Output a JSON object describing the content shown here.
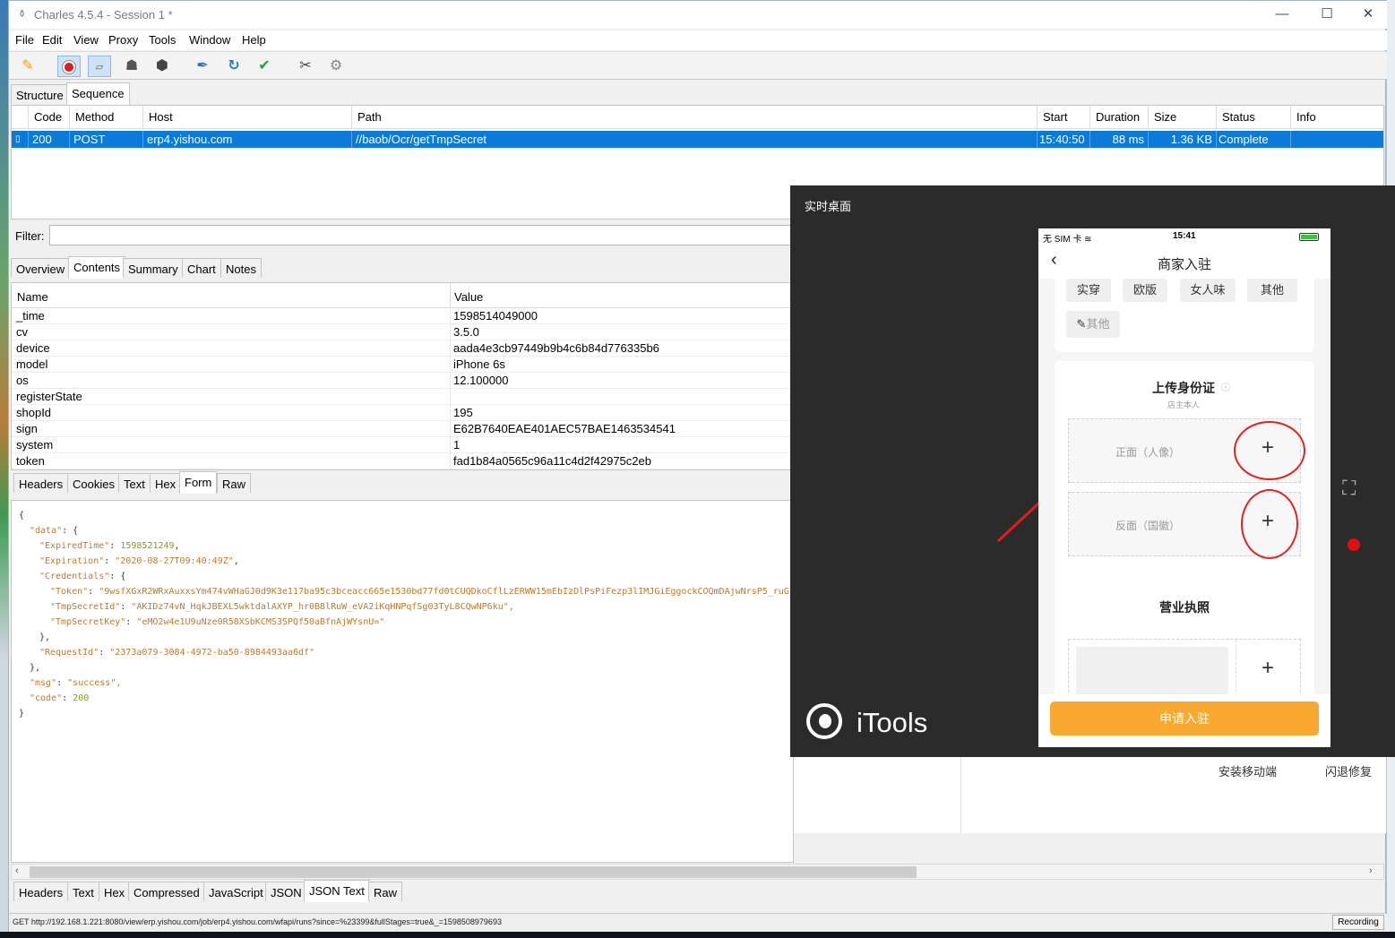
{
  "window": {
    "title": "Charles 4.5.4 - Session 1 *",
    "min": "—",
    "max": "☐",
    "close": "✕"
  },
  "menu": {
    "file": "File",
    "edit": "Edit",
    "view": "View",
    "proxy": "Proxy",
    "tools": "Tools",
    "window": "Window",
    "help": "Help"
  },
  "tabs": {
    "structure": "Structure",
    "sequence": "Sequence"
  },
  "table": {
    "headers": [
      "Code",
      "Method",
      "Host",
      "Path",
      "Start",
      "Duration",
      "Size",
      "Status",
      "Info"
    ],
    "row": {
      "code": "200",
      "method": "POST",
      "host": "erp4.yishou.com",
      "path": "//baob/Ocr/getTmpSecret",
      "start": "15:40:50",
      "duration": "88 ms",
      "size": "1.36 KB",
      "status": "Complete",
      "info": ""
    }
  },
  "filter": {
    "label": "Filter:",
    "value": ""
  },
  "detail_tabs": [
    "Overview",
    "Contents",
    "Summary",
    "Chart",
    "Notes"
  ],
  "kv": {
    "name_header": "Name",
    "value_header": "Value",
    "rows": [
      [
        "_time",
        "1598514049000"
      ],
      [
        "cv",
        "3.5.0"
      ],
      [
        "device",
        "aada4e3cb97449b9b4c6b84d776335b6"
      ],
      [
        "model",
        "iPhone 6s"
      ],
      [
        "os",
        "12.100000"
      ],
      [
        "registerState",
        ""
      ],
      [
        "shopId",
        "195"
      ],
      [
        "sign",
        "E62B7640EAE401AEC57BAE1463534541"
      ],
      [
        "system",
        "1"
      ],
      [
        "token",
        "fad1b84a0565c96a11c4d2f42975c2eb"
      ]
    ]
  },
  "request_tabs": [
    "Headers",
    "Cookies",
    "Text",
    "Hex",
    "Form",
    "Raw"
  ],
  "json": {
    "expired_time": "1598521249",
    "expiration": "\"2020-08-27T09:40:49Z\"",
    "token": "\"9wsfXGxR2WRxAuxxsYm474vWHaGJ0d9K3e117ba95c3bceacc665e1530bd77fd0tCUQDkoCflLzERWW15mEbIzDlPsPiFezp3lIMJGiEggockCOQmDAjwNrsP5_ruGs",
    "tmp_secret_id": "\"AKIDz74vN_HqkJBEXL5wktdalAXYP_hr0B8lRuW_eVA2iKqHNPqfSg03TyL8CQwNP6ku\",",
    "tmp_secret_key": "\"eMO2w4e1U9uNze0R58XSbKCMS3SPQf50aBfnAjWYsnU=\"",
    "request_id": "\"2373a079-3084-4972-ba50-8984493aa6df\"",
    "msg": "\"success\",",
    "code": "200"
  },
  "response_tabs": [
    "Headers",
    "Text",
    "Hex",
    "Compressed",
    "JavaScript",
    "JSON",
    "JSON Text",
    "Raw"
  ],
  "status": {
    "url": "GET http://192.168.1.221:8080/view/erp.yishou.com/job/erp4.yishou.com/wfapi/runs?since=%23399&fullStages=true&_=1598508979693",
    "recording": "Recording"
  },
  "itools": {
    "title": "实时桌面",
    "brand": "iTools",
    "install": "安装移动端",
    "repair": "闪退修复"
  },
  "phone": {
    "carrier": "无 SIM 卡",
    "time": "15:41",
    "page_title": "商家入驻",
    "tags": [
      "实穿",
      "欧版",
      "女人味",
      "其他"
    ],
    "custom_tag": "其他",
    "id_title": "上传身份证",
    "id_sub": "店主本人",
    "front": "正面（人像）",
    "back": "反面（国徽）",
    "license_title": "营业执照",
    "submit": "申请入驻",
    "plus": "+"
  }
}
